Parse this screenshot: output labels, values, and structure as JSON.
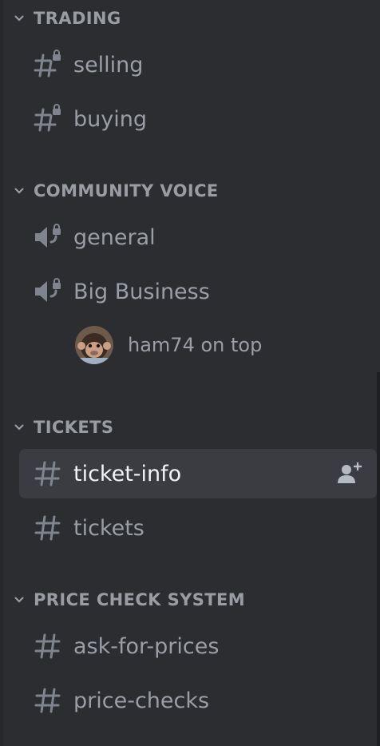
{
  "categories": [
    {
      "name": "TRADING",
      "channels": [
        {
          "label": "selling",
          "type": "text-locked"
        },
        {
          "label": "buying",
          "type": "text-locked"
        }
      ]
    },
    {
      "name": "COMMUNITY VOICE",
      "channels": [
        {
          "label": "general",
          "type": "voice-locked"
        },
        {
          "label": "Big Business",
          "type": "voice-locked",
          "users": [
            {
              "name": "ham74 on top"
            }
          ]
        }
      ]
    },
    {
      "name": "TICKETS",
      "channels": [
        {
          "label": "ticket-info",
          "type": "text",
          "selected": true
        },
        {
          "label": "tickets",
          "type": "text"
        }
      ]
    },
    {
      "name": "PRICE CHECK SYSTEM",
      "channels": [
        {
          "label": "ask-for-prices",
          "type": "text"
        },
        {
          "label": "price-checks",
          "type": "text"
        }
      ]
    }
  ],
  "colors": {
    "background": "#2b2d31",
    "selected_bg": "#3a3c42",
    "muted_text": "#9b9ea6",
    "selected_text": "#f2f3f5"
  }
}
